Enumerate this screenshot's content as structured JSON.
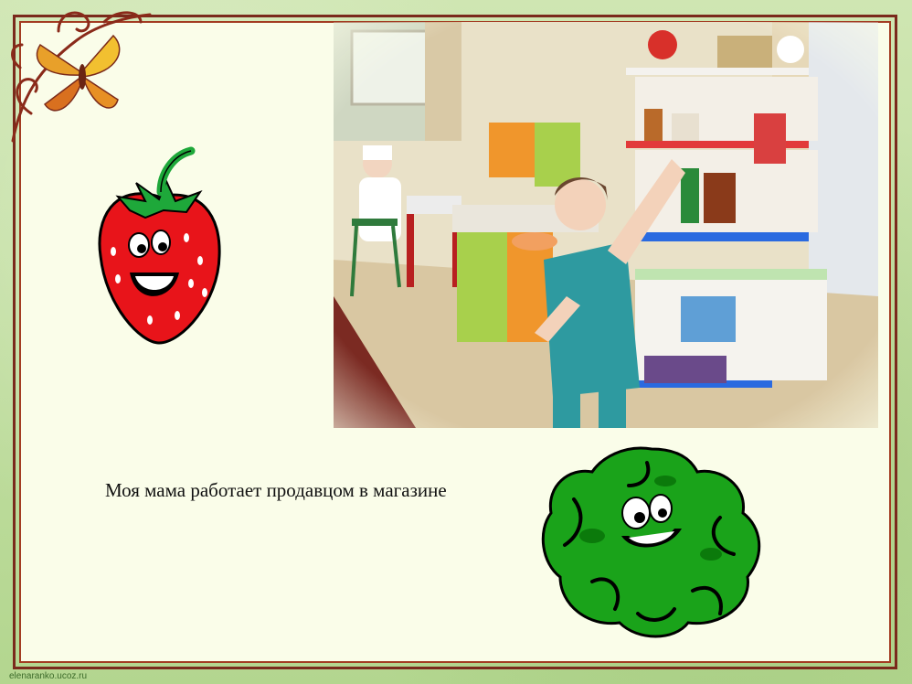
{
  "slide": {
    "caption": "Моя мама работает продавцом в магазине",
    "footer": "elenaranko.ucoz.ru"
  },
  "colors": {
    "background": "#b9d99a",
    "frame": "#7a2a1c",
    "panel": "#fafde9",
    "strawberry": "#e8141a",
    "lettuce": "#1aa31a"
  }
}
